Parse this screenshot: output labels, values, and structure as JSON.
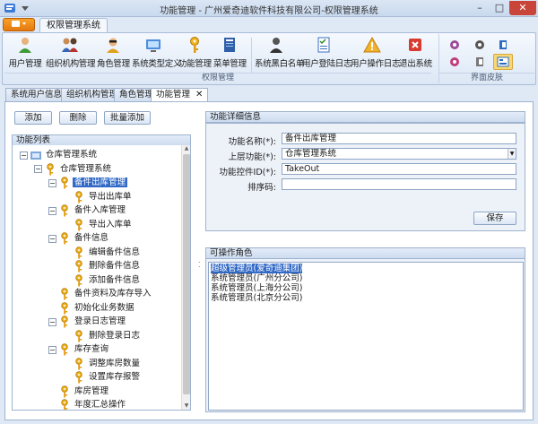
{
  "window": {
    "title": "功能管理 - 广州爱奇迪软件科技有限公司-权限管理系统",
    "minimize": "–",
    "maximize": "□",
    "close": "✕"
  },
  "ribbon": {
    "app_button": "",
    "tab": "权限管理系统",
    "group_label": "权限管理",
    "skin_group_label": "界面皮肤",
    "buttons": [
      {
        "label": "用户管理",
        "icon": "user-icon"
      },
      {
        "label": "组织机构管理",
        "icon": "organization-icon"
      },
      {
        "label": "角色管理",
        "icon": "role-icon"
      },
      {
        "label": "系统类型定义",
        "icon": "system-type-icon"
      },
      {
        "label": "功能管理",
        "icon": "key-icon"
      },
      {
        "label": "菜单管理",
        "icon": "menu-book-icon"
      },
      {
        "label": "系统黑白名单",
        "icon": "blacklist-user-icon"
      },
      {
        "label": "用户登陆日志",
        "icon": "login-log-icon"
      },
      {
        "label": "用户操作日志",
        "icon": "warning-icon"
      },
      {
        "label": "退出系统",
        "icon": "exit-icon"
      }
    ]
  },
  "doc_tabs": [
    "系统用户信息",
    "组织机构管理",
    "角色管理",
    "功能管理"
  ],
  "toolbar": {
    "add": "添加",
    "delete": "删除",
    "batch_add": "批量添加"
  },
  "tree": {
    "header": "功能列表",
    "nodes": [
      {
        "text": "仓库管理系统",
        "level": 0,
        "expander": "−",
        "icon": "folder"
      },
      {
        "text": "仓库管理系统",
        "level": 1,
        "expander": "−",
        "icon": "key"
      },
      {
        "text": "备件出库管理",
        "level": 2,
        "expander": "−",
        "icon": "key",
        "selected": true
      },
      {
        "text": "导出出库单",
        "level": 3,
        "expander": "",
        "icon": "key"
      },
      {
        "text": "备件入库管理",
        "level": 2,
        "expander": "−",
        "icon": "key"
      },
      {
        "text": "导出入库单",
        "level": 3,
        "expander": "",
        "icon": "key"
      },
      {
        "text": "备件信息",
        "level": 2,
        "expander": "−",
        "icon": "key"
      },
      {
        "text": "编辑备件信息",
        "level": 3,
        "expander": "",
        "icon": "key"
      },
      {
        "text": "删除备件信息",
        "level": 3,
        "expander": "",
        "icon": "key"
      },
      {
        "text": "添加备件信息",
        "level": 3,
        "expander": "",
        "icon": "key"
      },
      {
        "text": "备件资料及库存导入",
        "level": 2,
        "expander": "",
        "icon": "key"
      },
      {
        "text": "初始化业务数据",
        "level": 2,
        "expander": "",
        "icon": "key"
      },
      {
        "text": "登录日志管理",
        "level": 2,
        "expander": "−",
        "icon": "key"
      },
      {
        "text": "删除登录日志",
        "level": 3,
        "expander": "",
        "icon": "key"
      },
      {
        "text": "库存查询",
        "level": 2,
        "expander": "−",
        "icon": "key"
      },
      {
        "text": "调整库房数量",
        "level": 3,
        "expander": "",
        "icon": "key"
      },
      {
        "text": "设置库存报警",
        "level": 3,
        "expander": "",
        "icon": "key"
      },
      {
        "text": "库房管理",
        "level": 2,
        "expander": "",
        "icon": "key"
      },
      {
        "text": "年度汇总操作",
        "level": 2,
        "expander": "",
        "icon": "key"
      }
    ]
  },
  "detail": {
    "header": "功能详细信息",
    "name_label": "功能名称(*):",
    "name_value": "备件出库管理",
    "parent_label": "上层功能(*):",
    "parent_value": "仓库管理系统",
    "control_label": "功能控件ID(*):",
    "control_value": "TakeOut",
    "sort_label": "排序码:",
    "sort_value": "",
    "save": "保存"
  },
  "roles": {
    "header": "可操作角色",
    "items": [
      {
        "text": "超级管理员(爱奇迪集团)",
        "selected": true
      },
      {
        "text": "系统管理员(广州分公司)",
        "selected": false
      },
      {
        "text": "系统管理员(上海分公司)",
        "selected": false
      },
      {
        "text": "系统管理员(北京分公司)",
        "selected": false
      }
    ]
  },
  "colors": {
    "selection": "#3169c6",
    "accent_orange": "#f19021",
    "panel_border": "#9fb3cf"
  }
}
